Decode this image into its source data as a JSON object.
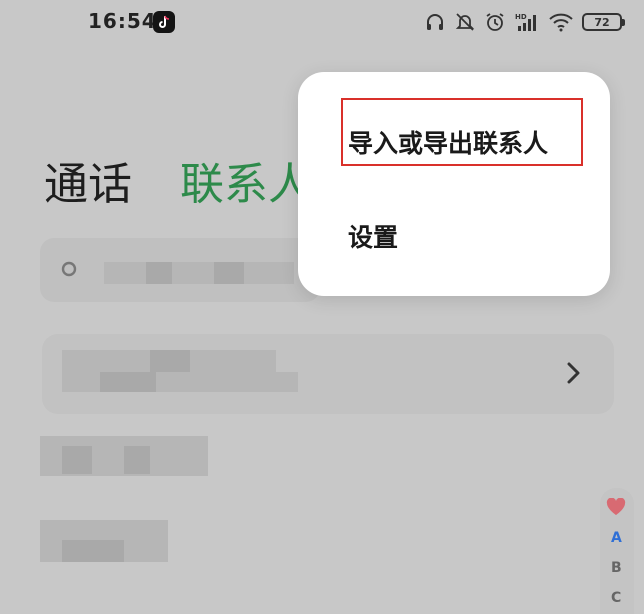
{
  "status_bar": {
    "time": "16:54",
    "battery": "72",
    "icons": [
      "tiktok-icon",
      "headphones-icon",
      "mute-icon",
      "alarm-icon",
      "hd-signal-icon",
      "wifi-icon",
      "battery-icon"
    ]
  },
  "header": {
    "tab_calls": "通话",
    "tab_contacts": "联系人"
  },
  "popup_menu": {
    "items": [
      {
        "label": "导入或导出联系人"
      },
      {
        "label": "设置"
      }
    ]
  },
  "alphabet_index": {
    "letters": [
      "A",
      "B",
      "C"
    ]
  },
  "colors": {
    "accent_green": "#2d8a4a",
    "highlight_red": "#d9302a",
    "index_blue": "#2f6fd6"
  }
}
